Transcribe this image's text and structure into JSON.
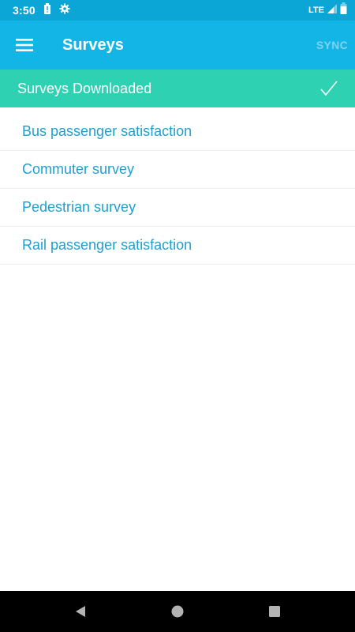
{
  "status_bar": {
    "time": "3:50",
    "network": "LTE",
    "icons": [
      "battery-alert-icon",
      "settings-icon",
      "signal-icon",
      "battery-icon"
    ]
  },
  "app_bar": {
    "title": "Surveys",
    "sync_label": "SYNC",
    "menu_icon": "hamburger-menu-icon"
  },
  "banner": {
    "text": "Surveys Downloaded",
    "icon": "check-icon"
  },
  "surveys": [
    {
      "label": "Bus passenger satisfaction"
    },
    {
      "label": "Commuter survey"
    },
    {
      "label": "Pedestrian survey"
    },
    {
      "label": "Rail passenger satisfaction"
    }
  ],
  "nav_bar": {
    "icons": [
      "back-icon",
      "home-icon",
      "recents-icon"
    ]
  },
  "colors": {
    "status_bar": "#0ba6d6",
    "app_bar": "#13b4e6",
    "banner": "#2fd1b3",
    "list_text": "#1f9fd0",
    "sync_disabled": "#7fd3ef"
  }
}
